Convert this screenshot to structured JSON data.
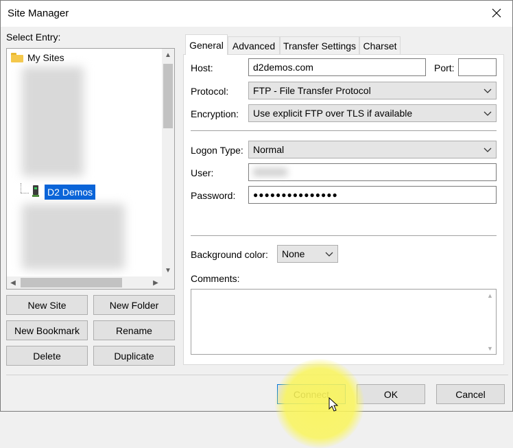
{
  "window": {
    "title": "Site Manager"
  },
  "left": {
    "select_label": "Select Entry:",
    "tree": {
      "root": "My Sites",
      "selected_site": "D2 Demos"
    },
    "buttons": {
      "new_site": "New Site",
      "new_folder": "New Folder",
      "new_bookmark": "New Bookmark",
      "rename": "Rename",
      "delete": "Delete",
      "duplicate": "Duplicate"
    }
  },
  "tabs": [
    {
      "label": "General",
      "active": true
    },
    {
      "label": "Advanced",
      "active": false
    },
    {
      "label": "Transfer Settings",
      "active": false
    },
    {
      "label": "Charset",
      "active": false
    }
  ],
  "general": {
    "host_label": "Host:",
    "host_value": "d2demos.com",
    "port_label": "Port:",
    "port_value": "",
    "protocol_label": "Protocol:",
    "protocol_value": "FTP - File Transfer Protocol",
    "encryption_label": "Encryption:",
    "encryption_value": "Use explicit FTP over TLS if available",
    "logon_type_label": "Logon Type:",
    "logon_type_value": "Normal",
    "user_label": "User:",
    "user_value": "",
    "password_label": "Password:",
    "password_value": "●●●●●●●●●●●●●●●",
    "bg_color_label": "Background color:",
    "bg_color_value": "None",
    "comments_label": "Comments:",
    "comments_value": ""
  },
  "footer": {
    "connect": "Connect",
    "ok": "OK",
    "cancel": "Cancel"
  },
  "colors": {
    "selection": "#0a64d8",
    "highlight": "#faf55a"
  }
}
